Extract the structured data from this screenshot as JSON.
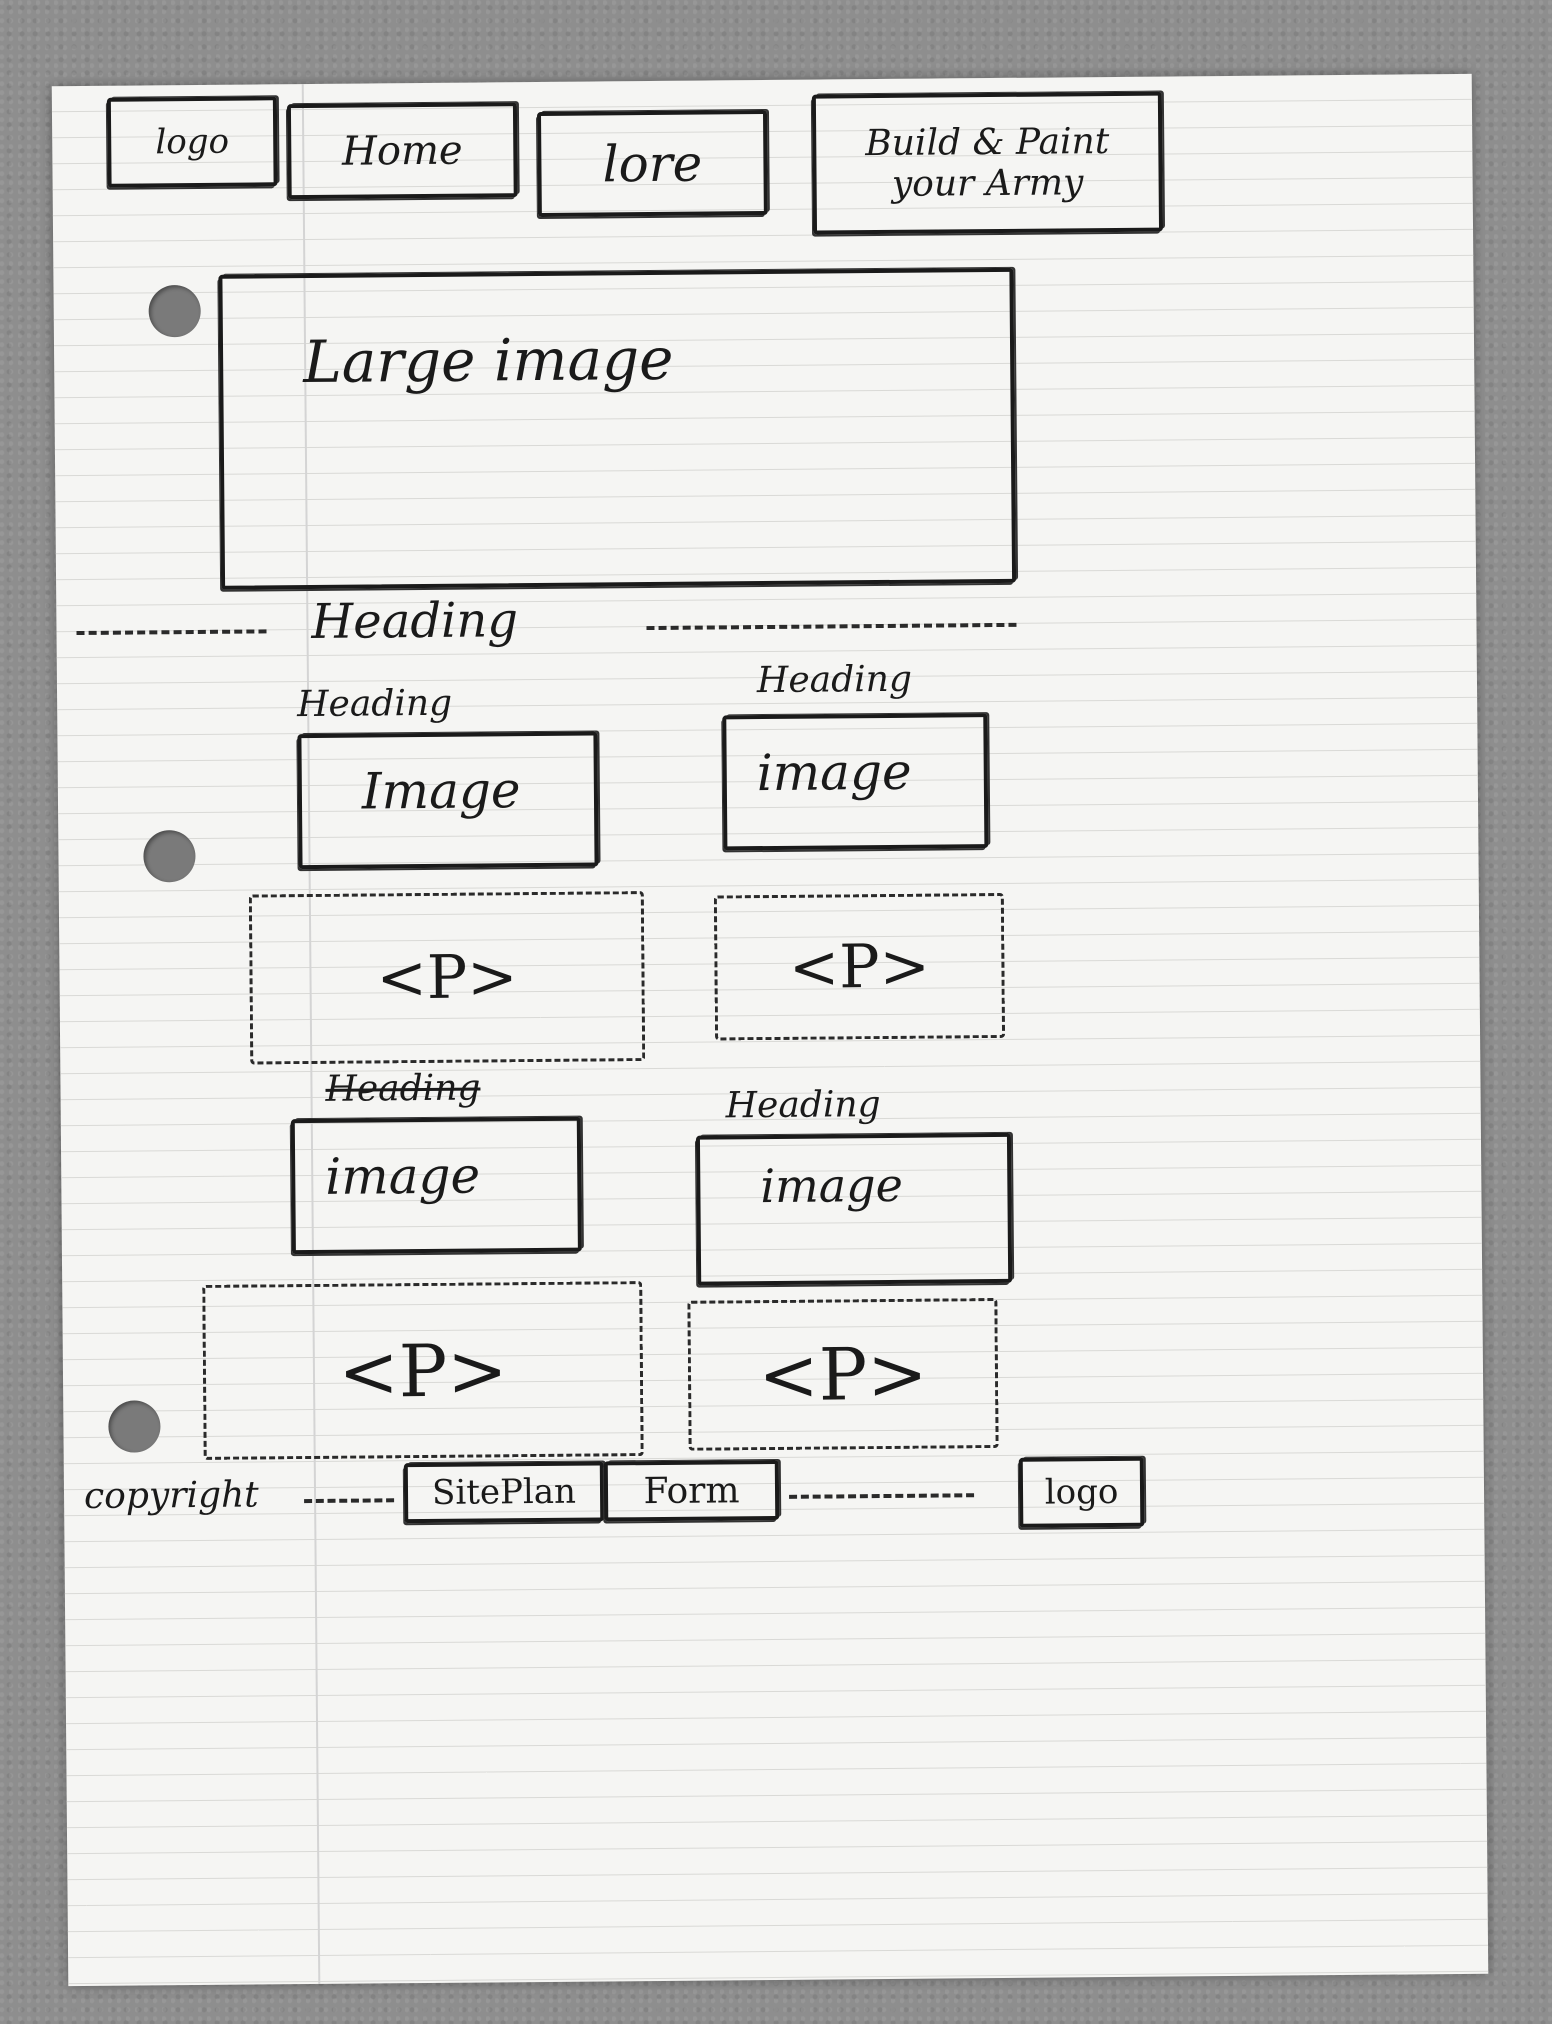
{
  "nav": {
    "logo": "logo",
    "home": "Home",
    "lore": "lore",
    "build_paint": "Build & Paint your Army"
  },
  "hero": {
    "label": "Large image"
  },
  "section_heading": "Heading",
  "cards": [
    {
      "heading": "Heading",
      "image": "Image",
      "paragraph": "<P>"
    },
    {
      "heading": "Heading",
      "image": "image",
      "paragraph": "<P>"
    },
    {
      "heading": "Heading",
      "image": "image",
      "paragraph": "<P>"
    },
    {
      "heading": "Heading",
      "image": "image",
      "paragraph": "<P>"
    }
  ],
  "footer": {
    "copyright": "copyright",
    "site_plan": "SitePlan",
    "form": "Form",
    "logo": "logo"
  }
}
